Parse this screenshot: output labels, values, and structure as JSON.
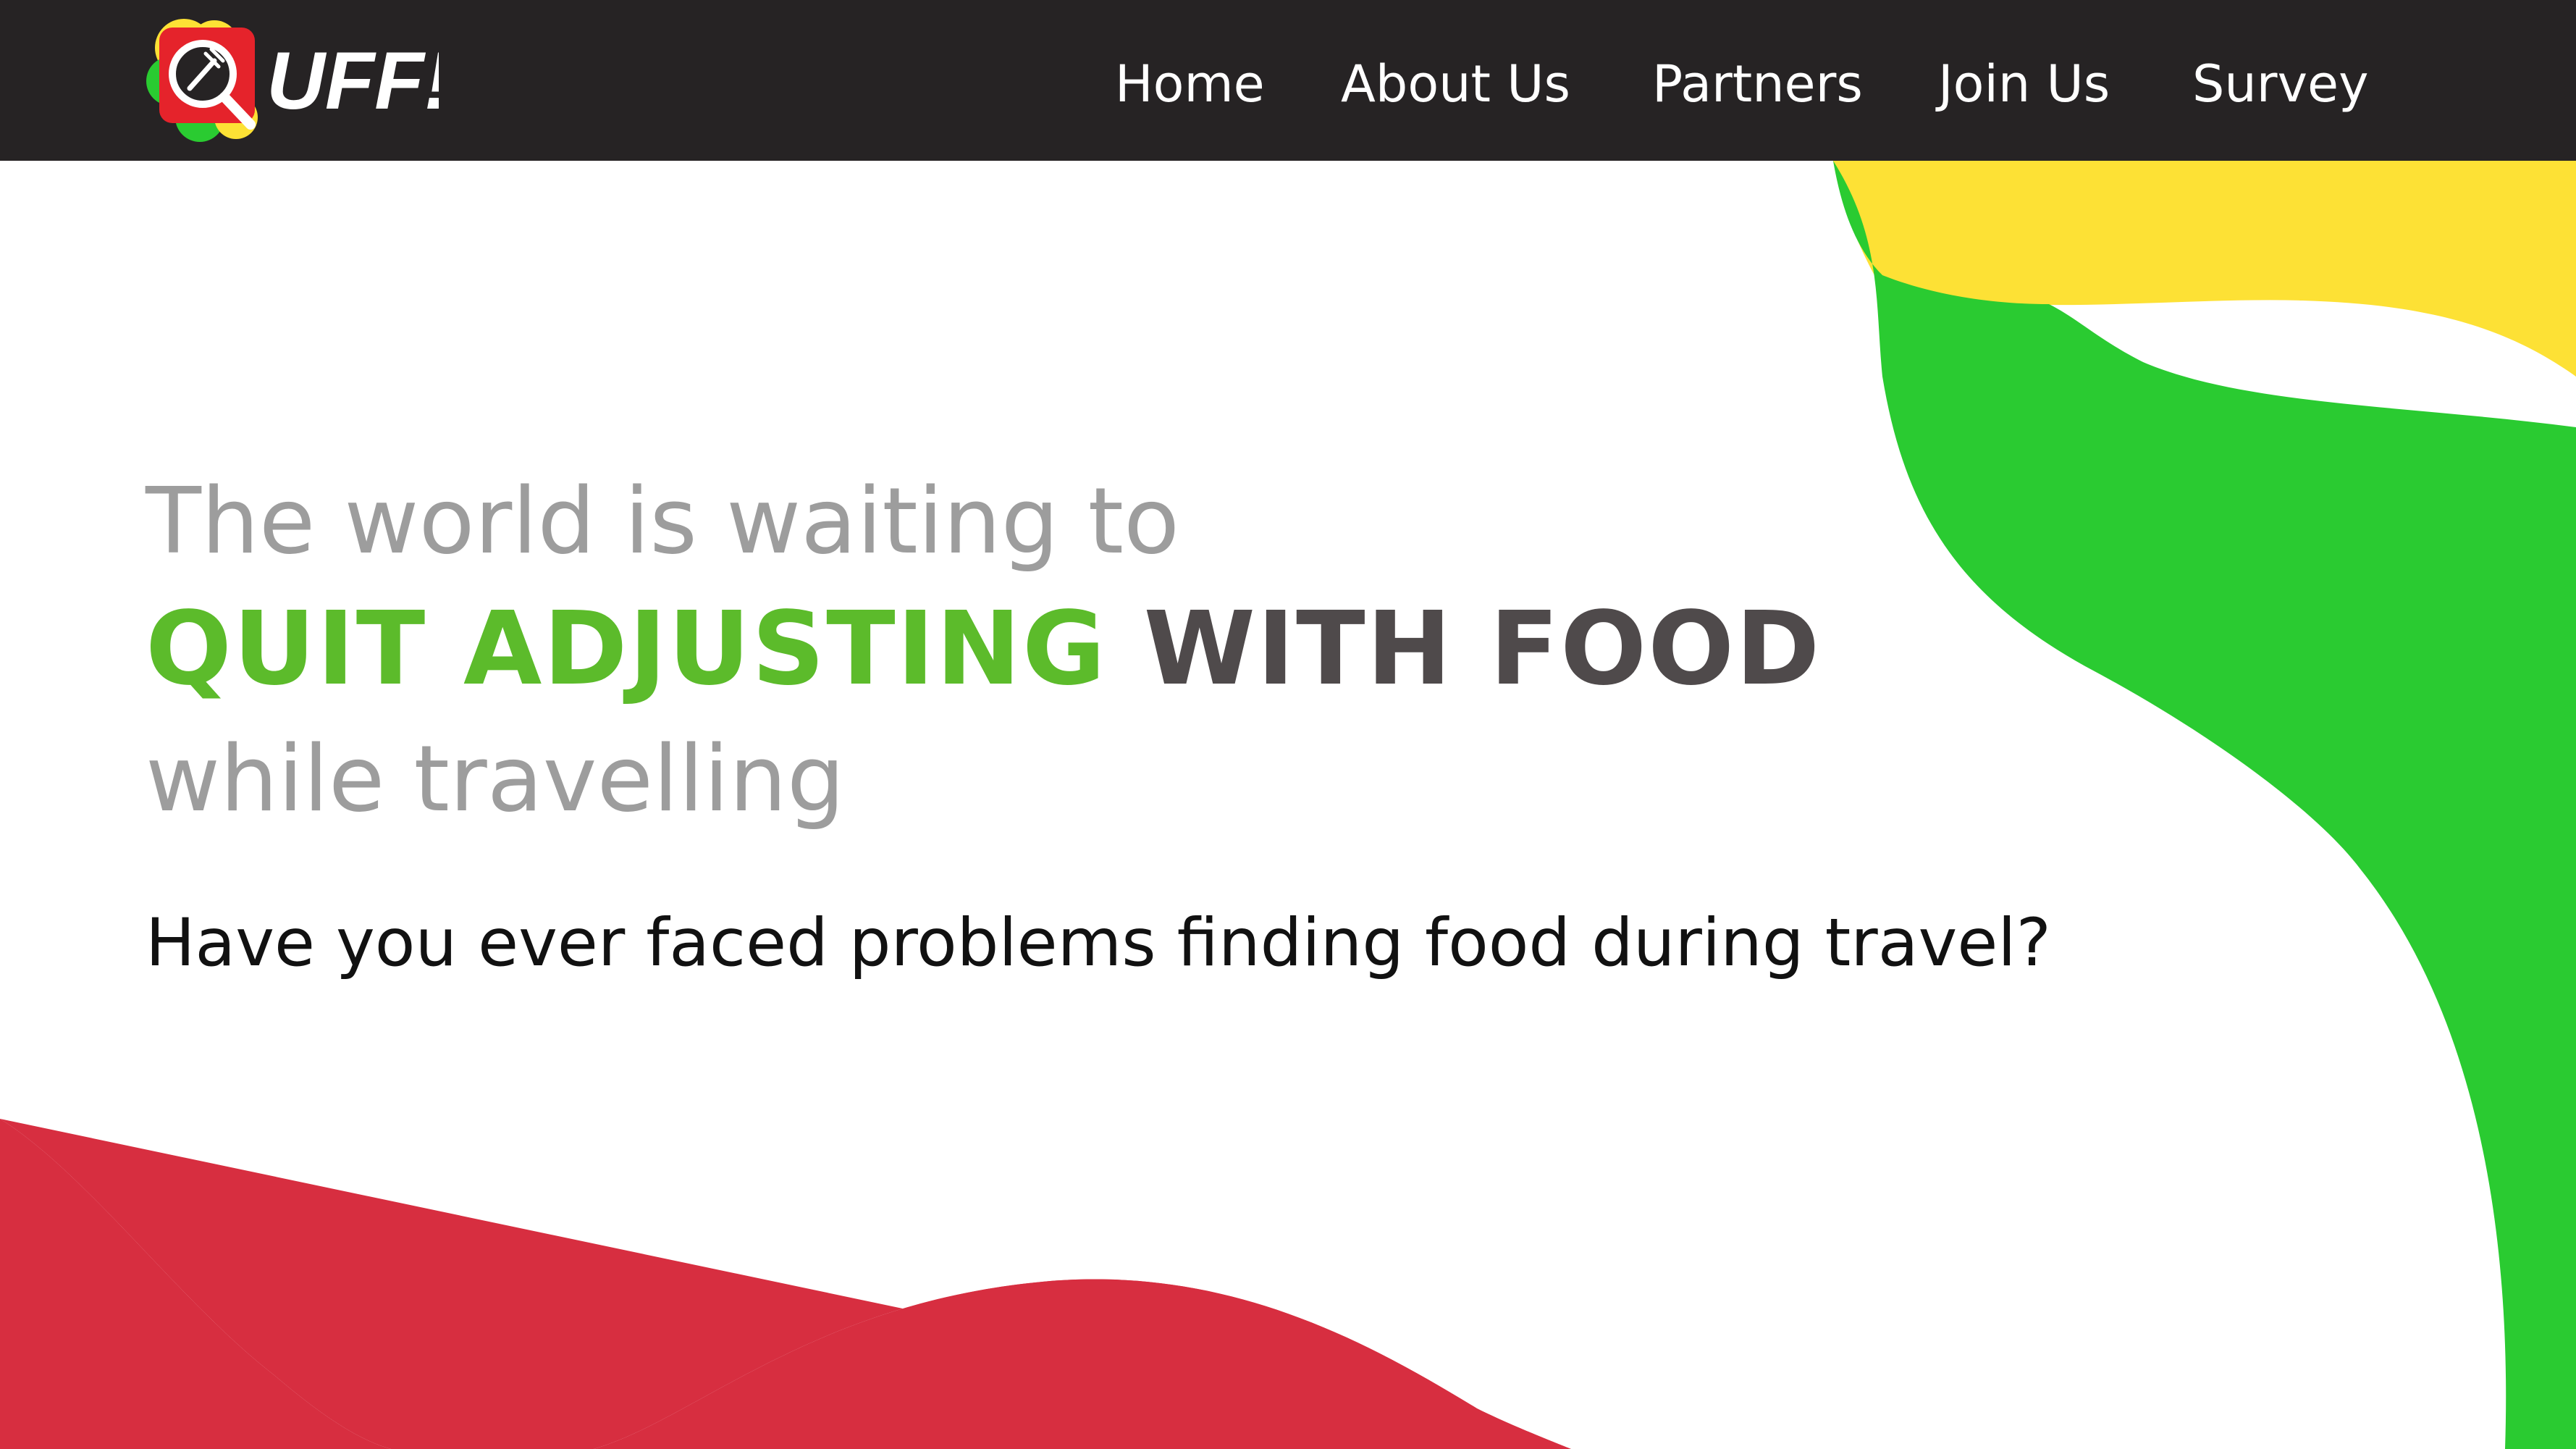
{
  "navbar": {
    "logo_text": "UFF!",
    "links": [
      {
        "label": "Home"
      },
      {
        "label": "About Us"
      },
      {
        "label": "Partners"
      },
      {
        "label": "Join Us"
      },
      {
        "label": "Survey"
      }
    ]
  },
  "hero": {
    "line1": "The world is waiting to",
    "line2_highlight": "QUIT ADJUSTING",
    "line2_rest": "WITH FOOD",
    "line3": "while travelling"
  },
  "question": "Have you ever faced problems finding food during travel?",
  "colors": {
    "navbar_bg": "#262324",
    "green": "#2acb31",
    "yellow": "#fde135",
    "red": "#d72e40",
    "headline_green": "#5cbb2b",
    "headline_dark": "#4f4a4b",
    "headline_gray": "#9d9d9d"
  },
  "icons": {
    "logo_icon": "search-fork-icon"
  }
}
